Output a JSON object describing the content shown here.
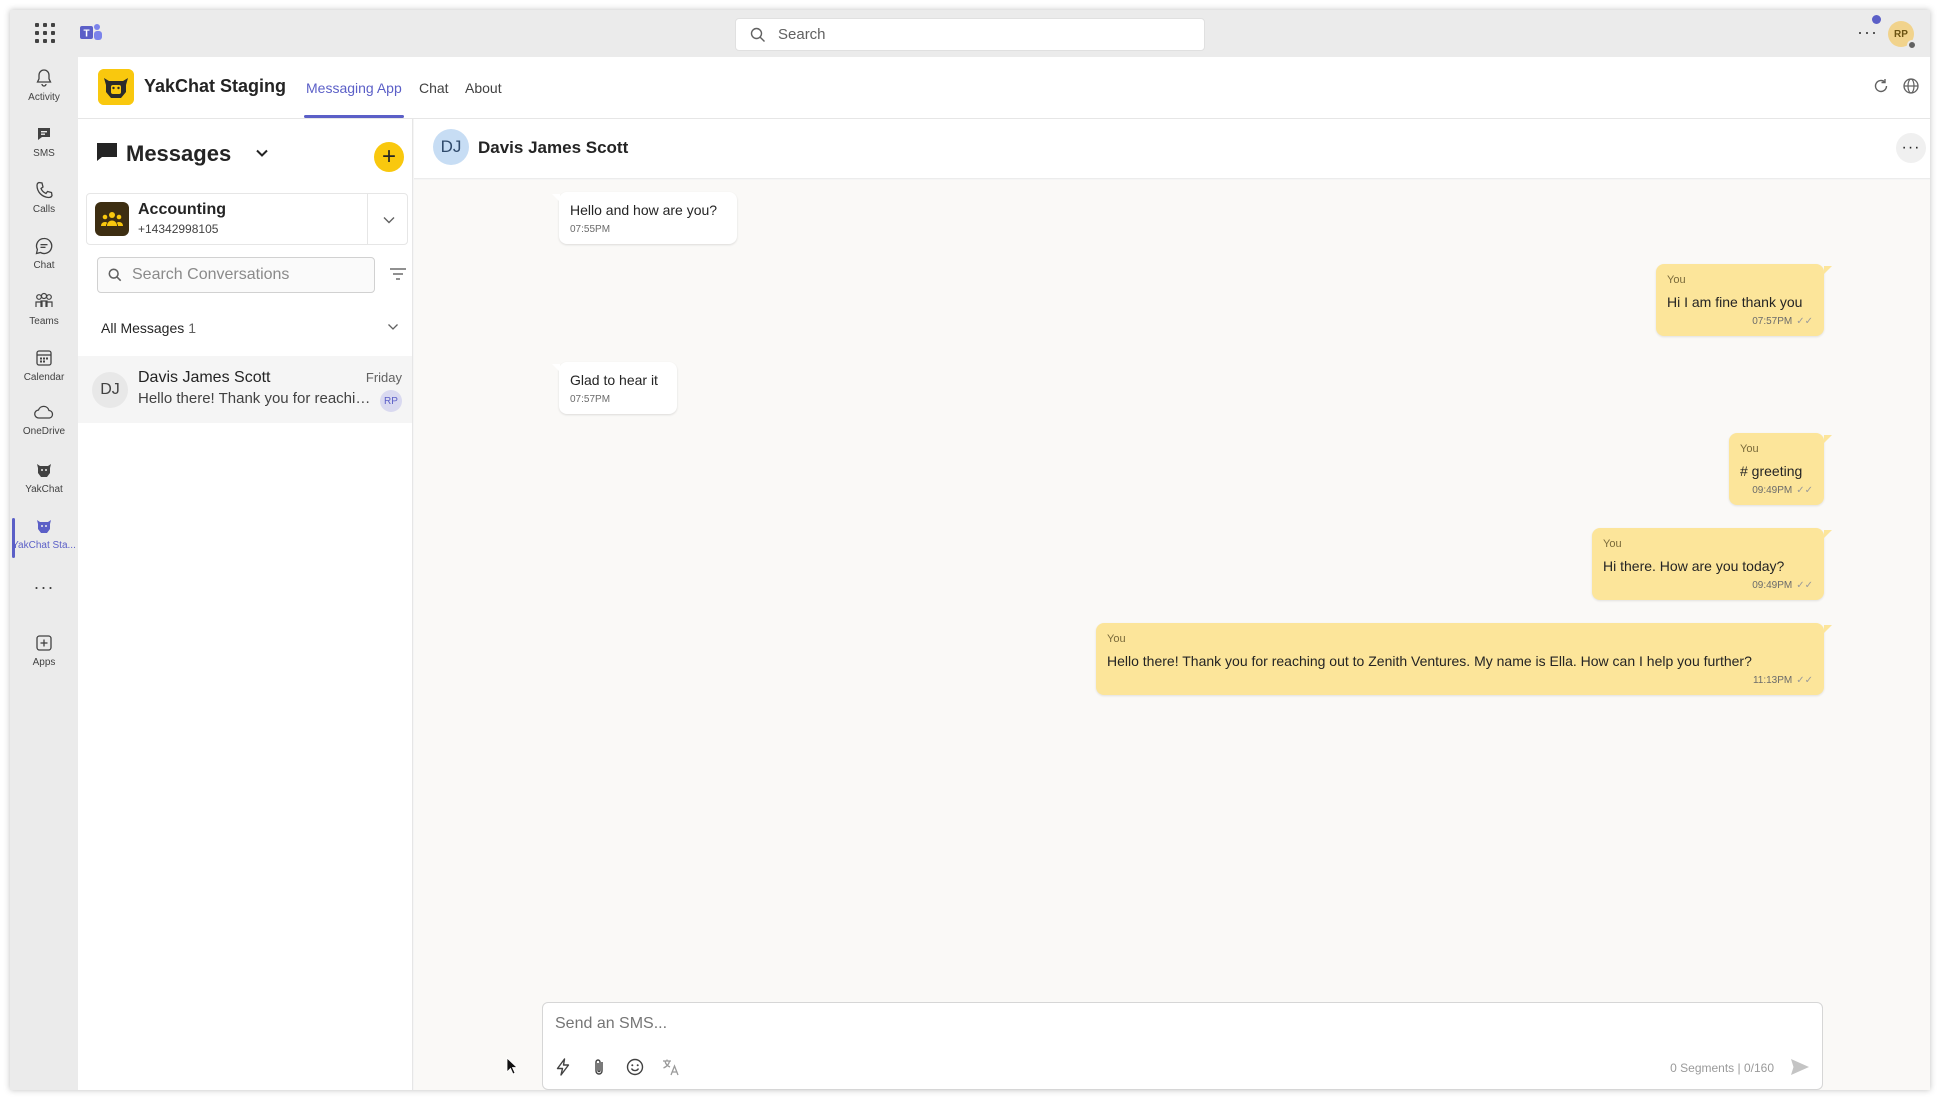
{
  "titlebar": {
    "search_placeholder": "Search",
    "more": "···",
    "avatar_initials": "RP"
  },
  "rail": {
    "items": [
      {
        "label": "Activity",
        "icon": "bell-icon"
      },
      {
        "label": "SMS",
        "icon": "sms-icon"
      },
      {
        "label": "Calls",
        "icon": "phone-icon"
      },
      {
        "label": "Chat",
        "icon": "chat-icon"
      },
      {
        "label": "Teams",
        "icon": "teams-icon"
      },
      {
        "label": "Calendar",
        "icon": "calendar-icon"
      },
      {
        "label": "OneDrive",
        "icon": "cloud-icon"
      },
      {
        "label": "YakChat",
        "icon": "yak-icon"
      },
      {
        "label": "YakChat Sta...",
        "icon": "yak-icon"
      },
      {
        "label": "Apps",
        "icon": "plus-square-icon"
      }
    ],
    "more": "···",
    "active_color": "#5b5fc7"
  },
  "app_header": {
    "title": "YakChat Staging",
    "tabs": [
      {
        "label": "Messaging App",
        "active": true
      },
      {
        "label": "Chat",
        "active": false
      },
      {
        "label": "About",
        "active": false
      }
    ],
    "brand_color": "#f9c80e"
  },
  "sidebar": {
    "title": "Messages",
    "add_label": "+",
    "account": {
      "name": "Accounting",
      "phone": "+14342998105"
    },
    "search_placeholder": "Search Conversations",
    "section": {
      "label": "All Messages",
      "count": "1"
    },
    "conversations": [
      {
        "initials": "DJ",
        "name": "Davis James Scott",
        "date": "Friday",
        "preview": "Hello there! Thank you for reaching out to Zenith Ventures. My name is Ella.",
        "badge": "RP"
      }
    ]
  },
  "chat": {
    "contact_initials": "DJ",
    "contact_name": "Davis James Scott",
    "more": "···",
    "messages": [
      {
        "direction": "in",
        "text": "Hello and how are you?",
        "time": "07:55PM"
      },
      {
        "direction": "out",
        "sender": "You",
        "text": "Hi I am fine thank you",
        "time": "07:57PM"
      },
      {
        "direction": "in",
        "text": "Glad to hear it",
        "time": "07:57PM"
      },
      {
        "direction": "out",
        "sender": "You",
        "text": "# greeting",
        "time": "09:49PM"
      },
      {
        "direction": "out",
        "sender": "You",
        "text": "Hi there.  How are you today?",
        "time": "09:49PM"
      },
      {
        "direction": "out",
        "sender": "You",
        "text": "Hello there!  Thank you for reaching out to Zenith Ventures.  My name is Ella.  How can I help you further?",
        "time": "11:13PM"
      }
    ],
    "check_mark": "✓✓",
    "outgoing_color": "#fce59a"
  },
  "composer": {
    "placeholder": "Send an SMS...",
    "segments": "0 Segments | 0/160"
  }
}
